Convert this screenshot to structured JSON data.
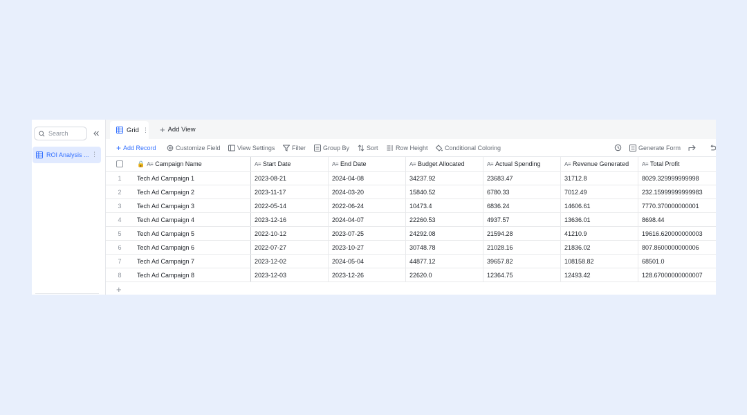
{
  "sidebar": {
    "search_placeholder": "Search",
    "collapse_icon": "double-chevron-left-icon",
    "items": [
      {
        "label": "ROI Analysis ...",
        "icon": "table-icon",
        "selected": true
      }
    ]
  },
  "tabs": {
    "active": "Grid",
    "add_view": "Add View"
  },
  "toolbar": {
    "add_record": "Add Record",
    "customize_field": "Customize Field",
    "view_settings": "View Settings",
    "filter": "Filter",
    "group_by": "Group By",
    "sort": "Sort",
    "row_height": "Row Height",
    "conditional_coloring": "Conditional Coloring",
    "generate_form": "Generate Form"
  },
  "columns": [
    "Campaign Name",
    "Start Date",
    "End Date",
    "Budget Allocated",
    "Actual Spending",
    "Revenue Generated",
    "Total Profit"
  ],
  "rows": [
    {
      "num": "1",
      "name": "Tech Ad Campaign 1",
      "start": "2023-08-21",
      "end": "2024-04-08",
      "budget": "34237.92",
      "spending": "23683.47",
      "revenue": "31712.8",
      "profit": "8029.329999999998"
    },
    {
      "num": "2",
      "name": "Tech Ad Campaign 2",
      "start": "2023-11-17",
      "end": "2024-03-20",
      "budget": "15840.52",
      "spending": "6780.33",
      "revenue": "7012.49",
      "profit": "232.15999999999983"
    },
    {
      "num": "3",
      "name": "Tech Ad Campaign 3",
      "start": "2022-05-14",
      "end": "2022-06-24",
      "budget": "10473.4",
      "spending": "6836.24",
      "revenue": "14606.61",
      "profit": "7770.370000000001"
    },
    {
      "num": "4",
      "name": "Tech Ad Campaign 4",
      "start": "2023-12-16",
      "end": "2024-04-07",
      "budget": "22260.53",
      "spending": "4937.57",
      "revenue": "13636.01",
      "profit": "8698.44"
    },
    {
      "num": "5",
      "name": "Tech Ad Campaign 5",
      "start": "2022-10-12",
      "end": "2023-07-25",
      "budget": "24292.08",
      "spending": "21594.28",
      "revenue": "41210.9",
      "profit": "19616.620000000003"
    },
    {
      "num": "6",
      "name": "Tech Ad Campaign 6",
      "start": "2022-07-27",
      "end": "2023-10-27",
      "budget": "30748.78",
      "spending": "21028.16",
      "revenue": "21836.02",
      "profit": "807.8600000000006"
    },
    {
      "num": "7",
      "name": "Tech Ad Campaign 7",
      "start": "2023-12-02",
      "end": "2024-05-04",
      "budget": "44877.12",
      "spending": "39657.82",
      "revenue": "108158.82",
      "profit": "68501.0"
    },
    {
      "num": "8",
      "name": "Tech Ad Campaign 8",
      "start": "2023-12-03",
      "end": "2023-12-26",
      "budget": "22620.0",
      "spending": "12364.75",
      "revenue": "12493.42",
      "profit": "128.67000000000007"
    }
  ],
  "colors": {
    "accent": "#3370ff",
    "background": "#e8effc",
    "selected_bg": "#e1eaff"
  }
}
